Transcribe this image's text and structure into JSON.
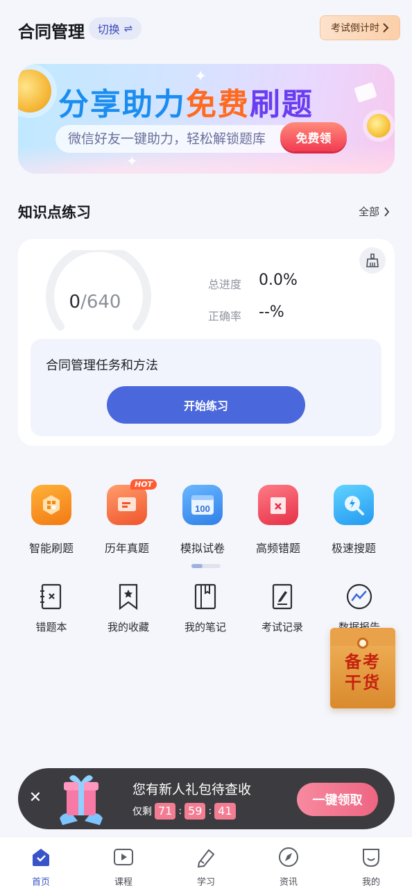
{
  "header": {
    "title": "合同管理",
    "switch_label": "切换",
    "switch_icon": "swap-icon",
    "countdown_label": "考试倒计时"
  },
  "banner": {
    "headline_part1": "分享助力",
    "headline_part2": "免费",
    "headline_part3": "刷题",
    "subtitle": "微信好友一键助力，轻松解锁题库",
    "button": "免费领"
  },
  "knowledge": {
    "section_title": "知识点练习",
    "all_label": "全部",
    "done": "0",
    "total": "/640",
    "progress_fraction": 0.0,
    "progress_label": "总进度",
    "progress_value": "0.0%",
    "accuracy_label": "正确率",
    "accuracy_value": "--%",
    "topic": "合同管理任务和方法",
    "start_button": "开始练习"
  },
  "features": [
    {
      "label": "智能刷题",
      "icon": "smart-practice-icon",
      "color": "#f7921e"
    },
    {
      "label": "历年真题",
      "icon": "past-exams-icon",
      "color": "#f56a3a",
      "badge": "HOT"
    },
    {
      "label": "模拟试卷",
      "icon": "mock-paper-icon",
      "color": "#3a8df0",
      "icon_text": "100"
    },
    {
      "label": "高频错题",
      "icon": "frequent-errors-icon",
      "color": "#ef4a5a"
    },
    {
      "label": "极速搜题",
      "icon": "quick-search-icon",
      "color": "#2eb3f5"
    }
  ],
  "tools": [
    {
      "label": "错题本",
      "icon": "wrong-book-icon"
    },
    {
      "label": "我的收藏",
      "icon": "bookmark-icon"
    },
    {
      "label": "我的笔记",
      "icon": "notebook-icon"
    },
    {
      "label": "考试记录",
      "icon": "exam-record-icon"
    },
    {
      "label": "数据报告",
      "icon": "data-report-icon"
    }
  ],
  "envelope": {
    "line1": "备考",
    "line2": "干货"
  },
  "gift": {
    "message": "您有新人礼包待查收",
    "remain_label": "仅剩",
    "hours": "71",
    "minutes": "59",
    "seconds": "41",
    "colon": ":",
    "claim_button": "一键领取"
  },
  "nav": [
    {
      "label": "首页",
      "icon": "home-icon",
      "active": true
    },
    {
      "label": "课程",
      "icon": "course-icon"
    },
    {
      "label": "学习",
      "icon": "study-icon"
    },
    {
      "label": "资讯",
      "icon": "news-icon"
    },
    {
      "label": "我的",
      "icon": "profile-icon"
    }
  ],
  "colors": {
    "primary": "#4a67dc",
    "nav_active": "#3954c9",
    "gift_bar": "#303034",
    "claim_button": "#ee6582"
  }
}
